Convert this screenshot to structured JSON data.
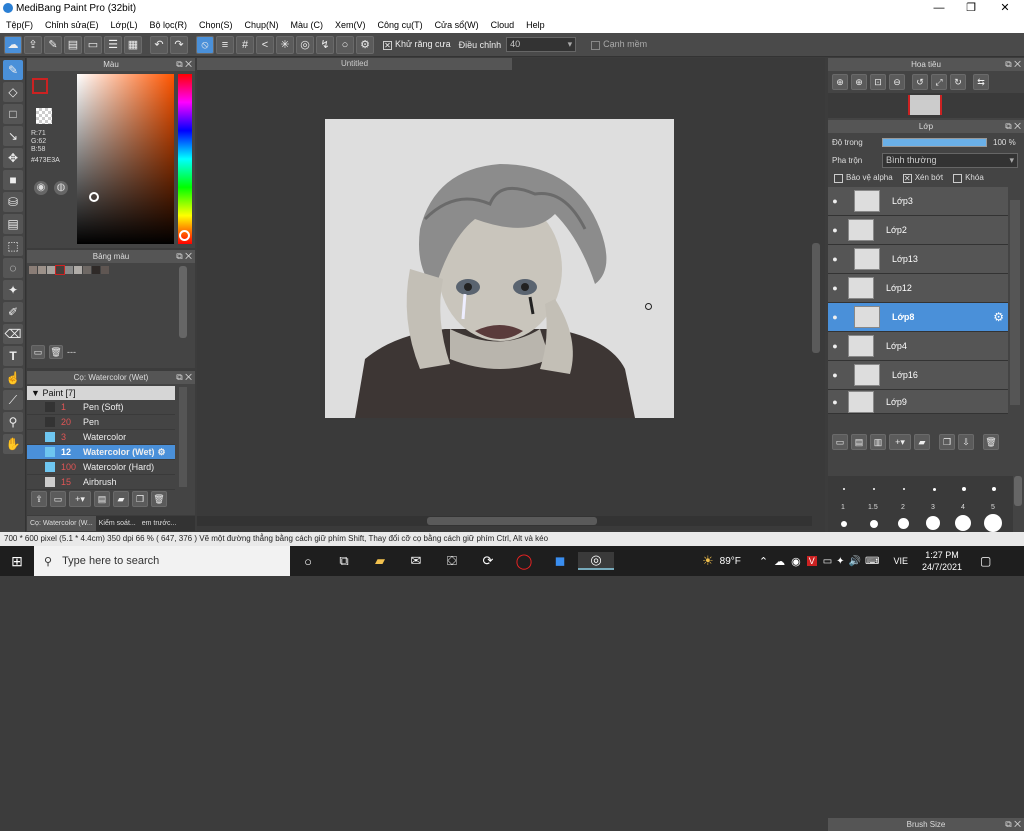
{
  "window": {
    "title": "MediBang Paint Pro (32bit)",
    "minimize": "—",
    "maximize": "❐",
    "close": "✕"
  },
  "menu": [
    "Tệp(F)",
    "Chỉnh sửa(E)",
    "Lớp(L)",
    "Bộ lọc(R)",
    "Chọn(S)",
    "Chụp(N)",
    "Màu (C)",
    "Xem(V)",
    "Công cụ(T)",
    "Cửa sổ(W)",
    "Cloud",
    "Help"
  ],
  "toolbar": {
    "antialias_label": "Khử răng cưa",
    "adjust_label": "Điều chỉnh",
    "adjust_value": "40",
    "snap_label": "Cạnh mềm"
  },
  "color_panel": {
    "title": "Màu",
    "r": "R:71",
    "g": "G:62",
    "b": "B:58",
    "hex": "#473E3A",
    "fg_color": "#473E3A"
  },
  "palette_panel": {
    "title": "Bảng màu",
    "dash": "---"
  },
  "brush_panel": {
    "title": "Cọ: Watercolor (Wet)",
    "group": "Paint [7]",
    "items": [
      {
        "size": "1",
        "name": "Pen (Soft)",
        "color": "#333333"
      },
      {
        "size": "20",
        "name": "Pen",
        "color": "#333333"
      },
      {
        "size": "3",
        "name": "Watercolor",
        "color": "#6ec6f0"
      },
      {
        "size": "12",
        "name": "Watercolor (Wet)",
        "color": "#6ec6f0"
      },
      {
        "size": "100",
        "name": "Watercolor (Hard)",
        "color": "#6ec6f0"
      },
      {
        "size": "15",
        "name": "Airbrush",
        "color": "#cccccc"
      }
    ],
    "tabs": [
      "Cọ: Watercolor (W...",
      "Kiểm soát...",
      "em trước..."
    ]
  },
  "canvas": {
    "tab_title": "Untitled"
  },
  "navigator": {
    "title": "Hoa tiêu"
  },
  "layer_panel": {
    "title": "Lớp",
    "opacity_label": "Độ trong",
    "opacity_value": "100 %",
    "blend_label": "Pha trộn",
    "blend_value": "Bình thường",
    "protect_alpha": "Bảo vệ alpha",
    "clipping": "Xén bớt",
    "lock": "Khóa",
    "layers": [
      "Lớp3",
      "Lớp2",
      "Lớp13",
      "Lớp12",
      "Lớp8",
      "Lớp4",
      "Lớp16",
      "Lớp9"
    ],
    "selected_layer": "Lớp8"
  },
  "brush_size_panel": {
    "title": "Brush Size",
    "sizes": [
      "1",
      "1.5",
      "2",
      "3",
      "4",
      "5"
    ]
  },
  "status": {
    "text": "700 * 600 pixel   (5.1 * 4.4cm)   350 dpi   66 %   ( 647, 376 )   Vẽ một đường thẳng bằng cách giữ phím Shift, Thay đổi cỡ cọ bằng cách giữ phím Ctrl, Alt và kéo"
  },
  "taskbar": {
    "search_placeholder": "Type here to search",
    "weather": "89°F",
    "lang": "VIE",
    "time": "1:27 PM",
    "date": "24/7/2021"
  }
}
